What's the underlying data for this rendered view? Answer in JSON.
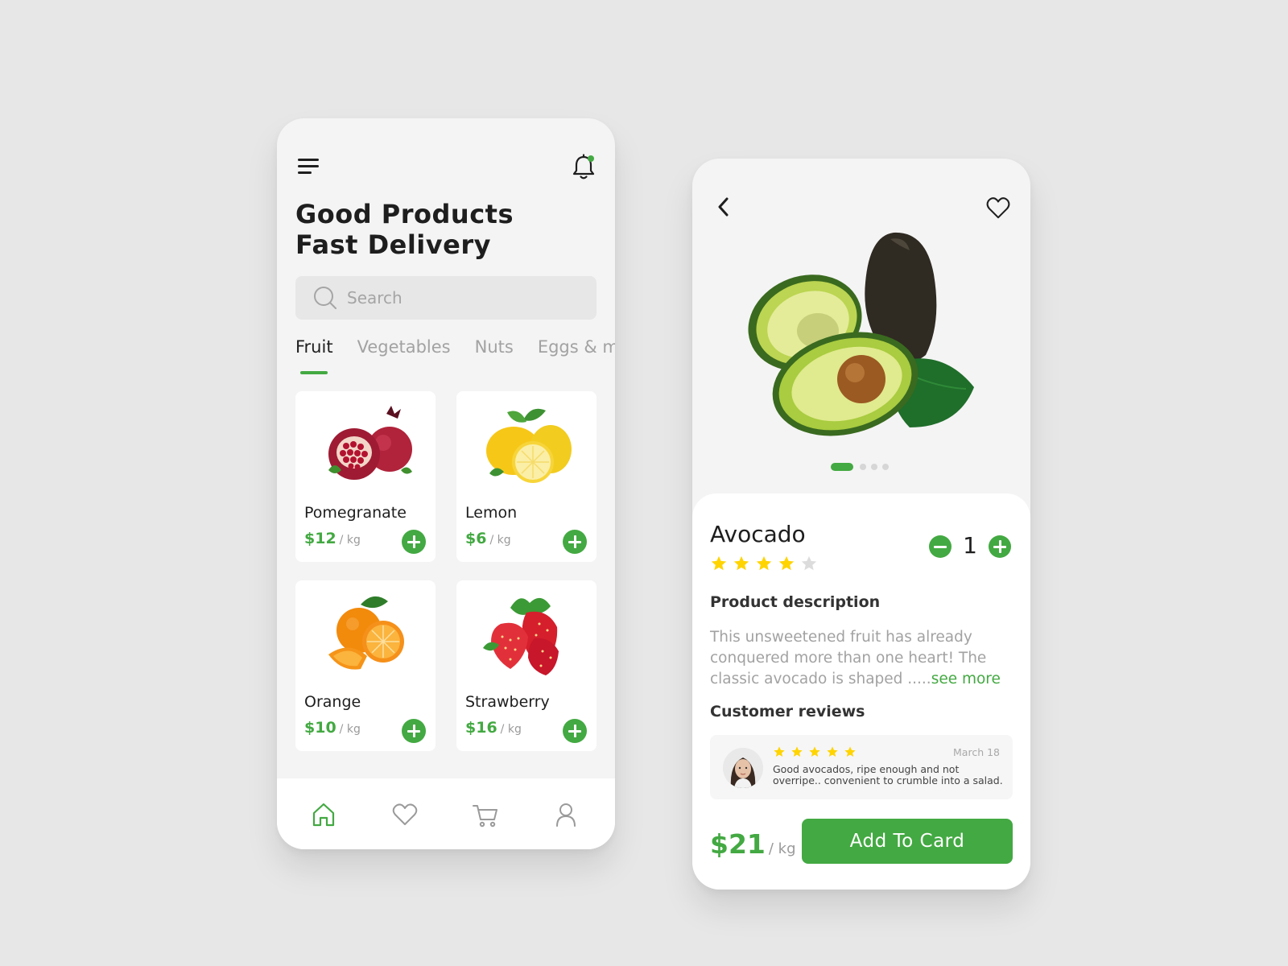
{
  "colors": {
    "accent": "#43a942",
    "background": "#e7e7e7",
    "card": "#ffffff",
    "muted": "#a2a2a2",
    "star": "#ffd400"
  },
  "home": {
    "icons": {
      "menu": "menu-icon",
      "notifications": "bell-icon",
      "search": "search-icon"
    },
    "title_line1": "Good Products",
    "title_line2": "Fast Delivery",
    "search_placeholder": "Search",
    "tabs": [
      {
        "label": "Fruit",
        "active": true
      },
      {
        "label": "Vegetables",
        "active": false
      },
      {
        "label": "Nuts",
        "active": false
      },
      {
        "label": "Eggs & m",
        "active": false
      }
    ],
    "products": [
      {
        "name": "Pomegranate",
        "price": "$12",
        "unit": "/ kg"
      },
      {
        "name": "Lemon",
        "price": "$6",
        "unit": "/ kg"
      },
      {
        "name": "Orange",
        "price": "$10",
        "unit": "/ kg"
      },
      {
        "name": "Strawberry",
        "price": "$16",
        "unit": "/ kg"
      }
    ],
    "bottom_nav": [
      {
        "icon": "home-icon",
        "active": true
      },
      {
        "icon": "heart-icon",
        "active": false
      },
      {
        "icon": "cart-icon",
        "active": false
      },
      {
        "icon": "profile-icon",
        "active": false
      }
    ]
  },
  "detail": {
    "icons": {
      "back": "chevron-left-icon",
      "favorite": "heart-icon"
    },
    "carousel": {
      "total": 4,
      "active": 1
    },
    "product_name": "Avocado",
    "rating": 4,
    "rating_max": 5,
    "quantity": "1",
    "description_title": "Product description",
    "description": "This unsweetened fruit has already conquered more than one heart! The classic avocado is shaped .....",
    "see_more": "see more",
    "reviews_title": "Customer reviews",
    "review": {
      "rating": 5,
      "date": "March 18",
      "text": "Good avocados, ripe enough and not overripe.. convenient to crumble into a salad."
    },
    "price": "$21",
    "unit": "/ kg",
    "cta_label": "Add To Card"
  }
}
